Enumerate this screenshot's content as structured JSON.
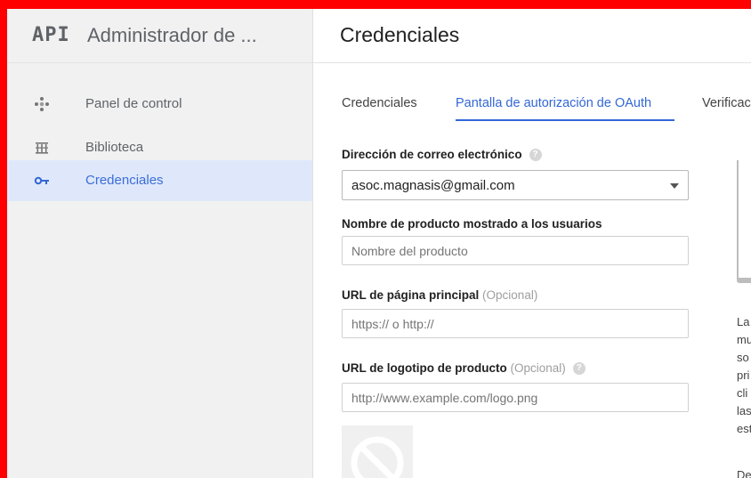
{
  "app": {
    "logo_text": "API",
    "title": "Administrador de ..."
  },
  "sidebar": {
    "items": [
      {
        "label": "Panel de control",
        "icon": "dashboard-icon",
        "active": false
      },
      {
        "label": "Biblioteca",
        "icon": "library-icon",
        "active": false
      },
      {
        "label": "Credenciales",
        "icon": "key-icon",
        "active": true
      }
    ]
  },
  "main": {
    "title": "Credenciales",
    "tabs": [
      {
        "label": "Credenciales",
        "active": false
      },
      {
        "label": "Pantalla de autorización de OAuth",
        "active": true
      },
      {
        "label": "Verificac",
        "active": false
      }
    ]
  },
  "form": {
    "email": {
      "label": "Dirección de correo electrónico",
      "value": "asoc.magnasis@gmail.com"
    },
    "product_name": {
      "label": "Nombre de producto mostrado a los usuarios",
      "placeholder": "Nombre del producto"
    },
    "homepage_url": {
      "label": "URL de página principal",
      "optional": "(Opcional)",
      "placeholder": "https:// o http://"
    },
    "logo_url": {
      "label": "URL de logotipo de producto",
      "optional": "(Opcional)",
      "placeholder": "http://www.example.com/logo.png"
    }
  },
  "side_panel": {
    "lines": [
      "La",
      "mu",
      "so",
      "pri",
      "cli",
      "las",
      "est"
    ],
    "tail": "De"
  },
  "colors": {
    "accent": "#3367d6",
    "active_bg": "#dfe8fb",
    "sidebar_bg": "#f1f1f1",
    "frame": "#ff0000"
  }
}
